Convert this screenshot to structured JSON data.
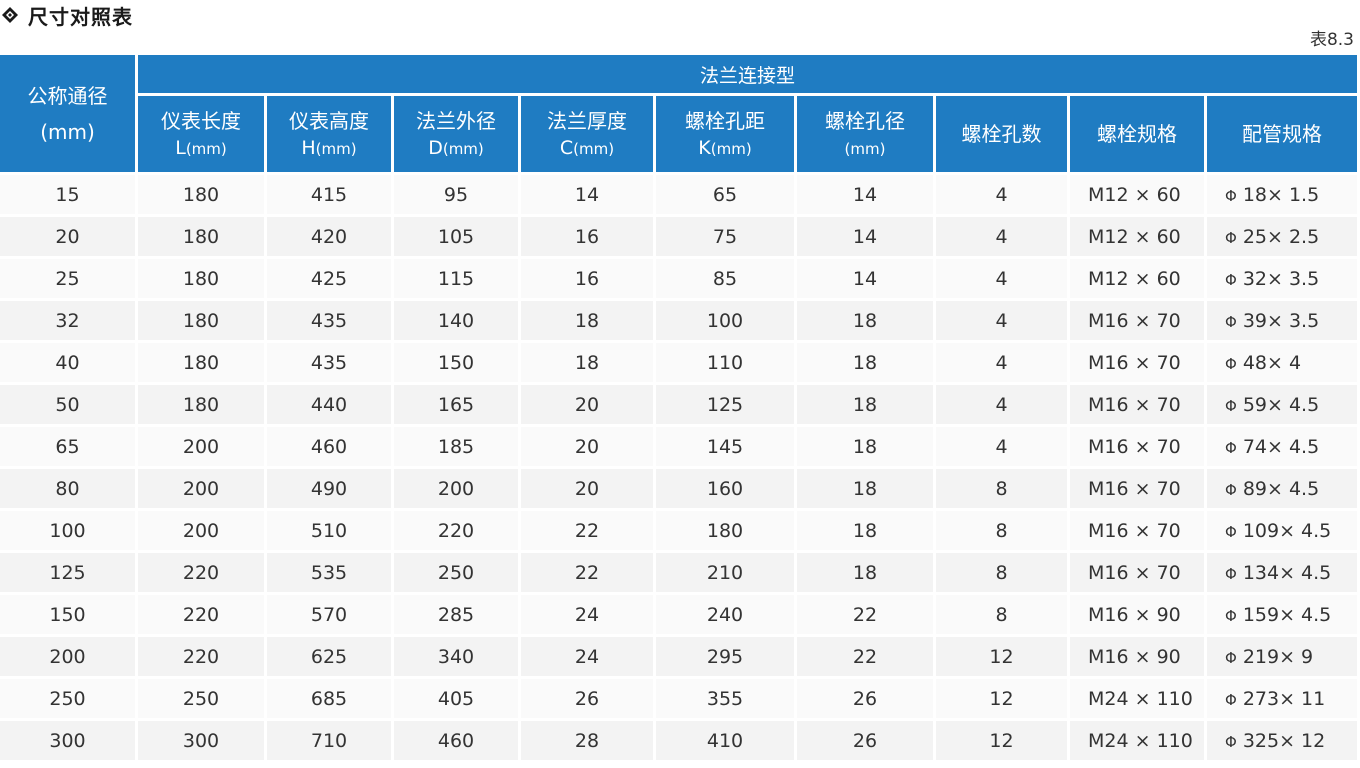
{
  "title": "尺寸对照表",
  "table_number": "表8.3",
  "header": {
    "nominal": "公称通径",
    "nominal_unit": "(mm)",
    "group": "法兰连接型",
    "columns": [
      {
        "label": "仪表长度",
        "sym": "L",
        "unit": "(mm)"
      },
      {
        "label": "仪表高度",
        "sym": "H",
        "unit": "(mm)"
      },
      {
        "label": "法兰外径",
        "sym": "D",
        "unit": "(mm)"
      },
      {
        "label": "法兰厚度",
        "sym": "C",
        "unit": "(mm)"
      },
      {
        "label": "螺栓孔距",
        "sym": "K",
        "unit": "(mm)"
      },
      {
        "label": "螺栓孔径",
        "sym": "",
        "unit": "(mm)"
      },
      {
        "label": "螺栓孔数",
        "sym": "",
        "unit": ""
      },
      {
        "label": "螺栓规格",
        "sym": "",
        "unit": ""
      },
      {
        "label": "配管规格",
        "sym": "",
        "unit": ""
      }
    ]
  },
  "rows": [
    [
      "15",
      "180",
      "415",
      "95",
      "14",
      "65",
      "14",
      "4",
      "M12 × 60",
      "Φ",
      "18× 1.5"
    ],
    [
      "20",
      "180",
      "420",
      "105",
      "16",
      "75",
      "14",
      "4",
      "M12 × 60",
      "Φ",
      "25× 2.5"
    ],
    [
      "25",
      "180",
      "425",
      "115",
      "16",
      "85",
      "14",
      "4",
      "M12 × 60",
      "Φ",
      "32× 3.5"
    ],
    [
      "32",
      "180",
      "435",
      "140",
      "18",
      "100",
      "18",
      "4",
      "M16 × 70",
      "Φ",
      "39× 3.5"
    ],
    [
      "40",
      "180",
      "435",
      "150",
      "18",
      "110",
      "18",
      "4",
      "M16 × 70",
      "Φ",
      "48× 4"
    ],
    [
      "50",
      "180",
      "440",
      "165",
      "20",
      "125",
      "18",
      "4",
      "M16 × 70",
      "Φ",
      "59× 4.5"
    ],
    [
      "65",
      "200",
      "460",
      "185",
      "20",
      "145",
      "18",
      "4",
      "M16 × 70",
      "Φ",
      "74× 4.5"
    ],
    [
      "80",
      "200",
      "490",
      "200",
      "20",
      "160",
      "18",
      "8",
      "M16 × 70",
      "Φ",
      "89× 4.5"
    ],
    [
      "100",
      "200",
      "510",
      "220",
      "22",
      "180",
      "18",
      "8",
      "M16 × 70",
      "Φ",
      "109× 4.5"
    ],
    [
      "125",
      "220",
      "535",
      "250",
      "22",
      "210",
      "18",
      "8",
      "M16 × 70",
      "Φ",
      "134× 4.5"
    ],
    [
      "150",
      "220",
      "570",
      "285",
      "24",
      "240",
      "22",
      "8",
      "M16 × 90",
      "Φ",
      "159× 4.5"
    ],
    [
      "200",
      "220",
      "625",
      "340",
      "24",
      "295",
      "22",
      "12",
      "M16 × 90",
      "Φ",
      "219× 9"
    ],
    [
      "250",
      "250",
      "685",
      "405",
      "26",
      "355",
      "26",
      "12",
      "M24 × 110",
      "Φ",
      "273× 11"
    ],
    [
      "300",
      "300",
      "710",
      "460",
      "28",
      "410",
      "26",
      "12",
      "M24 × 110",
      "Φ",
      "325× 12"
    ]
  ],
  "colors": {
    "header_bg": "#1f7cc2",
    "row_bg_a": "#fafafa",
    "row_bg_b": "#f3f3f3"
  }
}
